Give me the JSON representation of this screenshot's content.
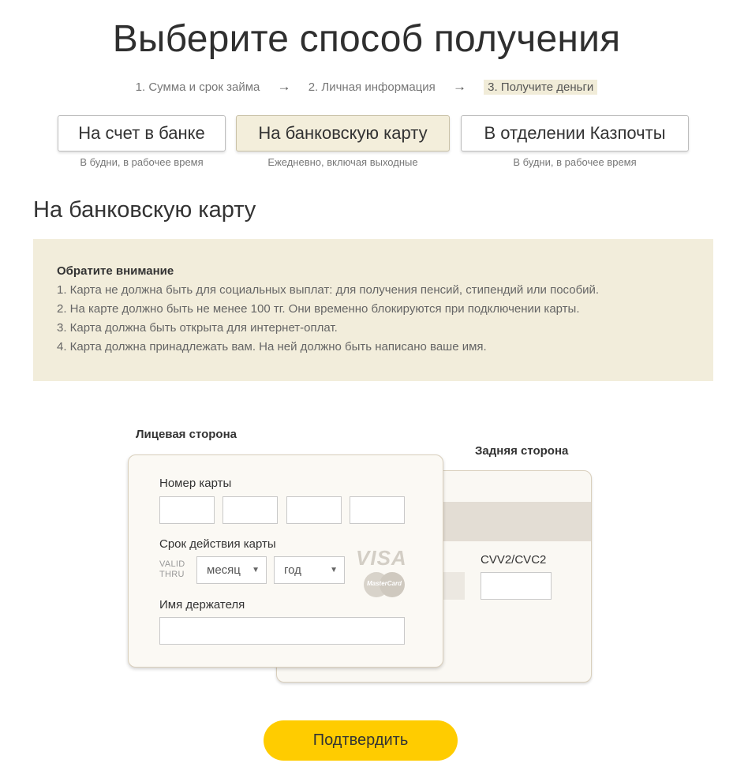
{
  "page": {
    "title": "Выберите способ получения"
  },
  "steps": [
    {
      "label": "1. Сумма и срок займа"
    },
    {
      "label": "2. Личная информация"
    },
    {
      "label": "3. Получите деньги"
    }
  ],
  "steps_arrow": "→",
  "methods": [
    {
      "label": "На счет в банке",
      "note": "В будни, в рабочее время",
      "selected": false
    },
    {
      "label": "На банковскую карту",
      "note": "Ежедневно, включая выходные",
      "selected": true
    },
    {
      "label": "В отделении Казпочты",
      "note": "В будни, в рабочее время",
      "selected": false
    }
  ],
  "section": {
    "title": "На банковскую карту"
  },
  "notice": {
    "title": "Обратите внимание",
    "items": [
      "1. Карта не должна быть для социальных выплат: для получения пенсий, стипендий или пособий.",
      "2. На карте должно быть не менее 100 тг. Они временно блокируются при подключении карты.",
      "3. Карта должна быть открыта для интернет-оплат.",
      "4. Карта должна принадлежать вам. На ней должно быть написано ваше имя."
    ]
  },
  "card_front": {
    "side_label": "Лицевая сторона",
    "number_label": "Номер карты",
    "expiry_label": "Срок действия карты",
    "valid_thru_line1": "VALID",
    "valid_thru_line2": "THRU",
    "month_select": "месяц",
    "year_select": "год",
    "holder_label": "Имя держателя",
    "visa_logo": "VISA",
    "mastercard_logo": "MasterCard",
    "caret": "▼"
  },
  "card_back": {
    "side_label": "Задняя сторона",
    "cvv_label": "CVV2/CVC2"
  },
  "actions": {
    "confirm_label": "Подтвердить"
  },
  "colors": {
    "accent_yellow": "#ffcc00",
    "notice_bg": "#f2eddb",
    "selected_tab_bg": "#f3eedb",
    "card_bg": "#fbf9f4"
  }
}
